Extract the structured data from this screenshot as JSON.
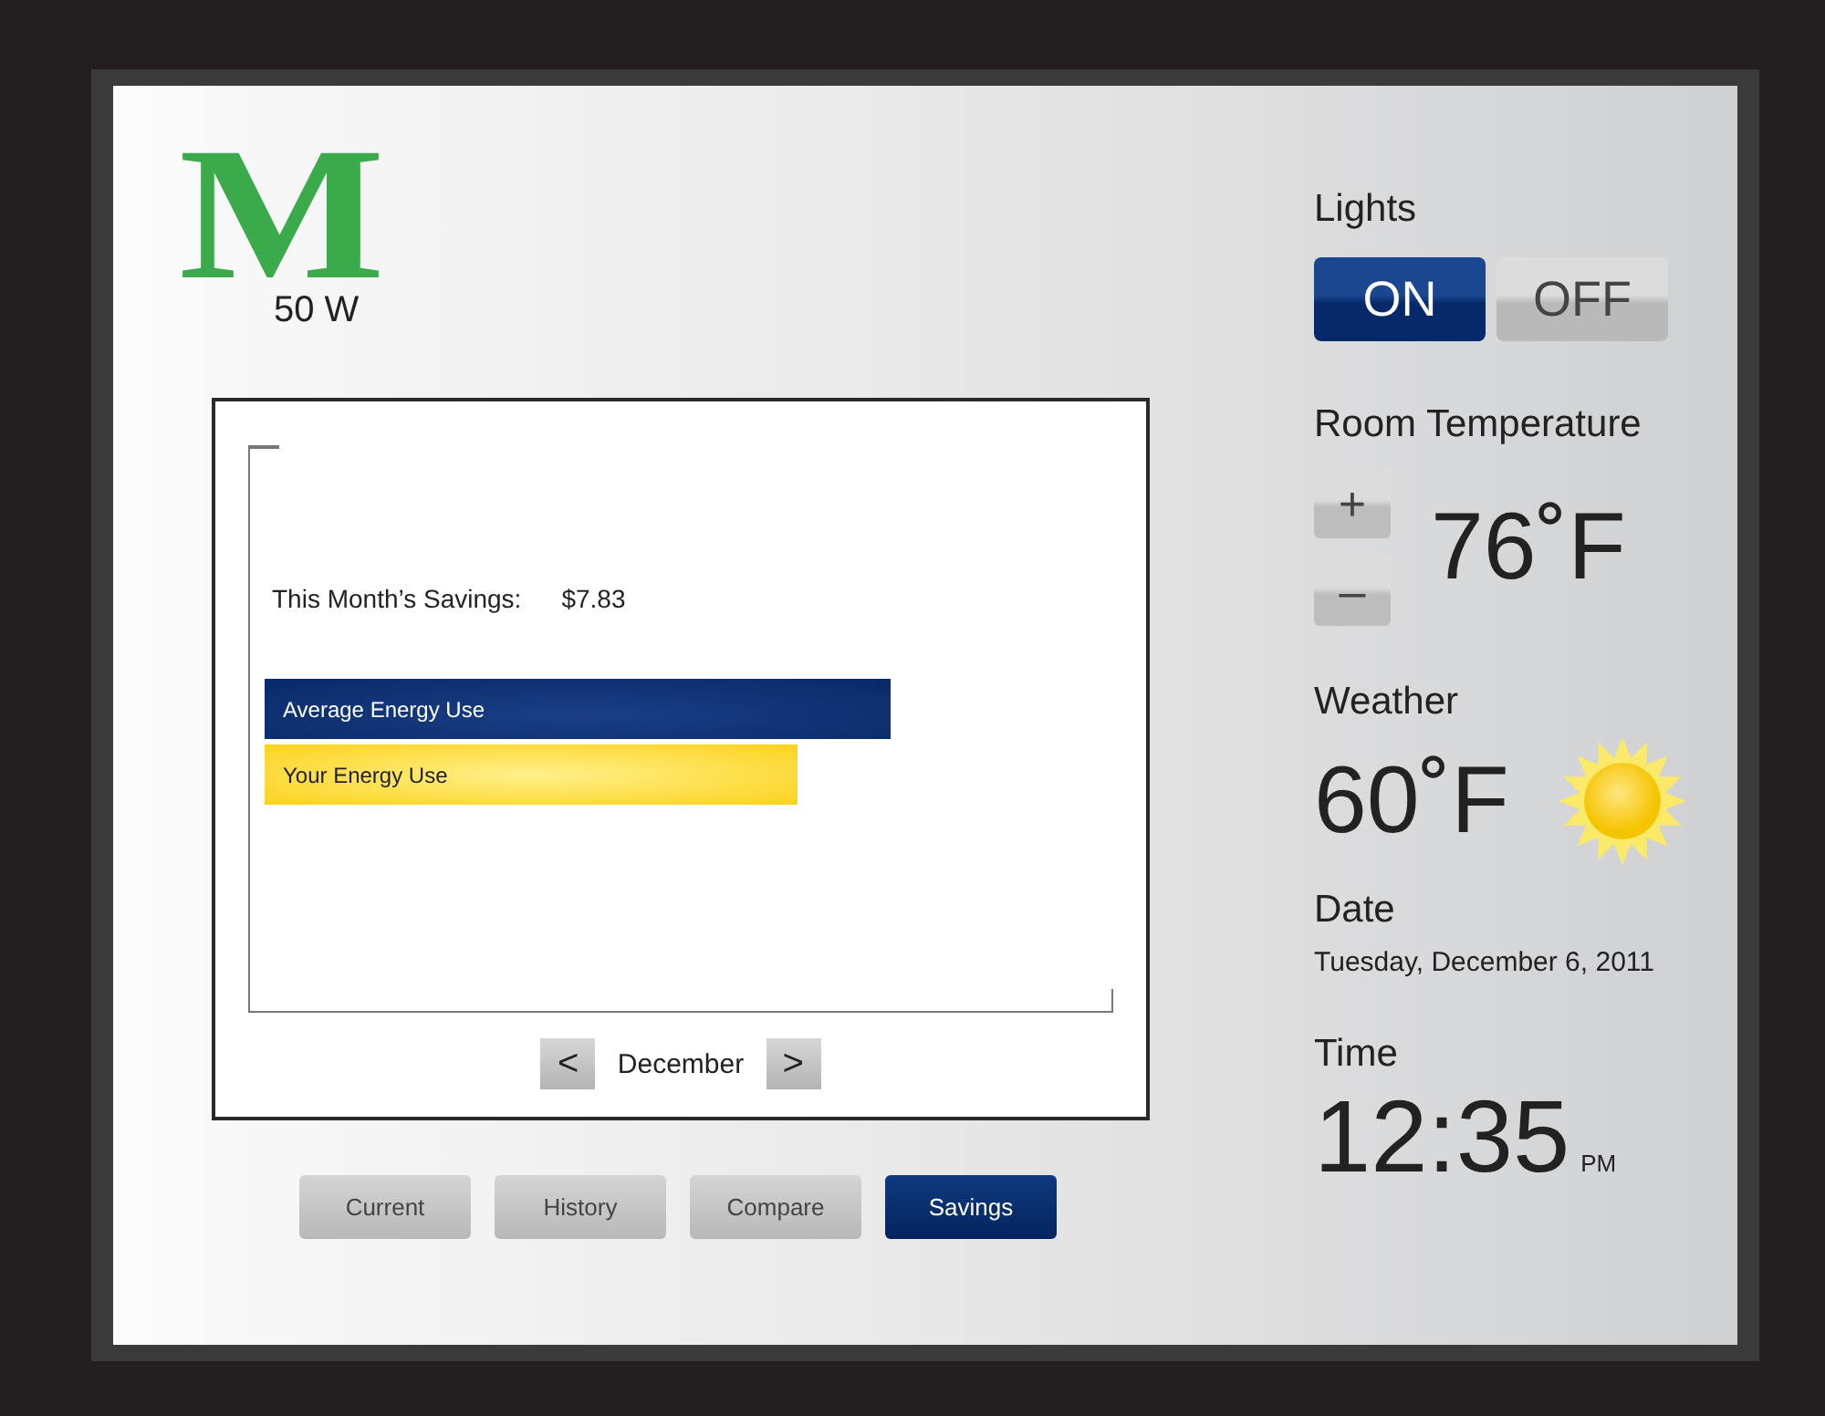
{
  "logo": {
    "letter": "M",
    "power": "50 W"
  },
  "chart_panel": {
    "savings_label": "This Month’s Savings:",
    "savings_value": "$7.83",
    "bars": [
      {
        "label": "Average Energy Use",
        "kind": "average"
      },
      {
        "label": "Your Energy Use",
        "kind": "yours"
      }
    ],
    "month_nav": {
      "prev": "<",
      "month": "December",
      "next": ">"
    }
  },
  "tabs": [
    {
      "label": "Current",
      "selected": false
    },
    {
      "label": "History",
      "selected": false
    },
    {
      "label": "Compare",
      "selected": false
    },
    {
      "label": "Savings",
      "selected": true
    }
  ],
  "lights": {
    "title": "Lights",
    "options": [
      {
        "label": "ON",
        "selected": true
      },
      {
        "label": "OFF",
        "selected": false
      }
    ]
  },
  "room_temperature": {
    "title": "Room Temperature",
    "increase": "+",
    "decrease": "–",
    "value": "76˚F"
  },
  "weather": {
    "title": "Weather",
    "value": "60˚F"
  },
  "date": {
    "title": "Date",
    "value": "Tuesday, December 6, 2011"
  },
  "time": {
    "title": "Time",
    "value": "12:35",
    "suffix": "PM"
  }
}
